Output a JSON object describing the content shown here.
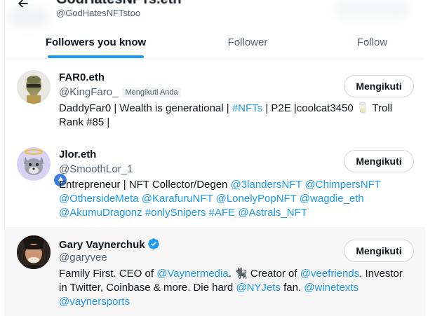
{
  "header": {
    "back_icon": "arrow-left-icon",
    "profile_name": "GodHatesNFTs.eth",
    "profile_handle": "@GodHatesNFTstoo"
  },
  "tabs": [
    {
      "label": "Followers you know",
      "active": true
    },
    {
      "label": "Follower",
      "active": false
    },
    {
      "label": "Follow",
      "active": false
    }
  ],
  "users": [
    {
      "name": "FAR0.eth",
      "handle": "@KingFaro_",
      "follows_you": "Mengikuti Anda",
      "button": "Mengikuti",
      "bio": [
        {
          "t": "DaddyFar0 | Wealth is generational | "
        },
        {
          "t": "#NFTs",
          "link": true
        },
        {
          "t": " | P2E |coolcat3450 🥛 Troll Rank #85 |"
        }
      ]
    },
    {
      "name": "Jlor.eth",
      "handle": "@SmoothLor_1",
      "button": "Mengikuti",
      "bio": [
        {
          "t": "Entrepreneur | NFT Collector/Degen "
        },
        {
          "t": "@3landersNFT",
          "link": true
        },
        {
          "t": " "
        },
        {
          "t": "@ChimpersNFT",
          "link": true
        },
        {
          "t": " "
        },
        {
          "t": "@OthersideMeta",
          "link": true
        },
        {
          "t": " "
        },
        {
          "t": "@KarafuruNFT",
          "link": true
        },
        {
          "t": " "
        },
        {
          "t": "@LonelyPopNFT",
          "link": true
        },
        {
          "t": " "
        },
        {
          "t": "@wagdie_eth",
          "link": true
        },
        {
          "t": " "
        },
        {
          "t": "@AkumuDragonz",
          "link": true
        },
        {
          "t": " "
        },
        {
          "t": "#onlySnipers",
          "link": true
        },
        {
          "t": " "
        },
        {
          "t": "#AFE",
          "link": true
        },
        {
          "t": " "
        },
        {
          "t": "@Astrals_NFT",
          "link": true
        }
      ]
    },
    {
      "name": "Gary Vaynerchuk",
      "handle": "@garyvee",
      "verified": true,
      "button": "Mengikuti",
      "bio": [
        {
          "t": "Family First. CEO of "
        },
        {
          "t": "@Vaynermedia",
          "link": true
        },
        {
          "t": ". 🐈‍⬛ Creator of "
        },
        {
          "t": "@veefriends",
          "link": true
        },
        {
          "t": ". Investor in Twitter, Coinbase & more. Die hard "
        },
        {
          "t": "@NYJets",
          "link": true
        },
        {
          "t": " fan. "
        },
        {
          "t": "@winetexts",
          "link": true
        },
        {
          "t": " "
        },
        {
          "t": "@vaynersports",
          "link": true
        }
      ]
    }
  ],
  "colors": {
    "accent": "#1d9bf0",
    "text_primary": "#0f1419",
    "text_secondary": "#536471",
    "hover_bg": "#f7f7f7"
  }
}
